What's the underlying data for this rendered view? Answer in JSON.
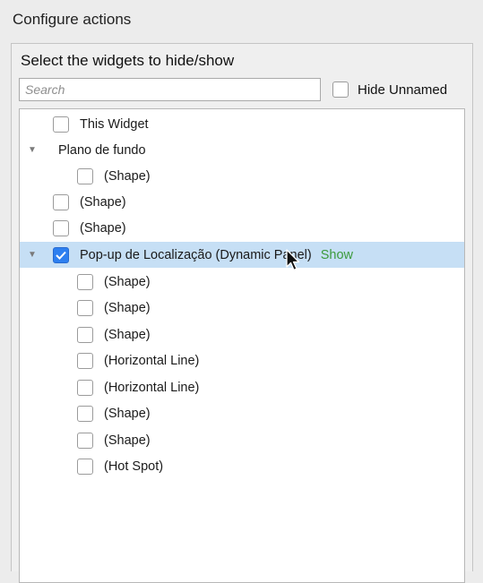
{
  "section_title": "Configure actions",
  "panel": {
    "label": "Select the widgets to hide/show",
    "search_placeholder": "Search",
    "hide_unnamed_label": "Hide Unnamed"
  },
  "tree": [
    {
      "label": "This Widget",
      "checked": false,
      "caret": false
    },
    {
      "label": "Plano de fundo",
      "checked": null,
      "caret": true
    },
    {
      "label": "(Shape)",
      "checked": false,
      "caret": false
    },
    {
      "label": "(Shape)",
      "checked": false,
      "caret": false
    },
    {
      "label": "(Shape)",
      "checked": false,
      "caret": false
    },
    {
      "label": "Pop-up de Localização (Dynamic Panel)",
      "checked": true,
      "caret": true,
      "action": "Show",
      "selected": true
    },
    {
      "label": "(Shape)",
      "checked": false,
      "caret": false
    },
    {
      "label": "(Shape)",
      "checked": false,
      "caret": false
    },
    {
      "label": "(Shape)",
      "checked": false,
      "caret": false
    },
    {
      "label": "(Horizontal Line)",
      "checked": false,
      "caret": false
    },
    {
      "label": "(Horizontal Line)",
      "checked": false,
      "caret": false
    },
    {
      "label": "(Shape)",
      "checked": false,
      "caret": false
    },
    {
      "label": "(Shape)",
      "checked": false,
      "caret": false
    },
    {
      "label": "(Hot Spot)",
      "checked": false,
      "caret": false
    }
  ],
  "icons": {
    "caret": "caret-down-icon",
    "check": "checkmark-icon",
    "cursor": "mouse-pointer-icon"
  },
  "colors": {
    "selected_row": "#c6dff5",
    "checkbox_checked": "#2d7ff0",
    "action_text": "#3c9a3c"
  }
}
